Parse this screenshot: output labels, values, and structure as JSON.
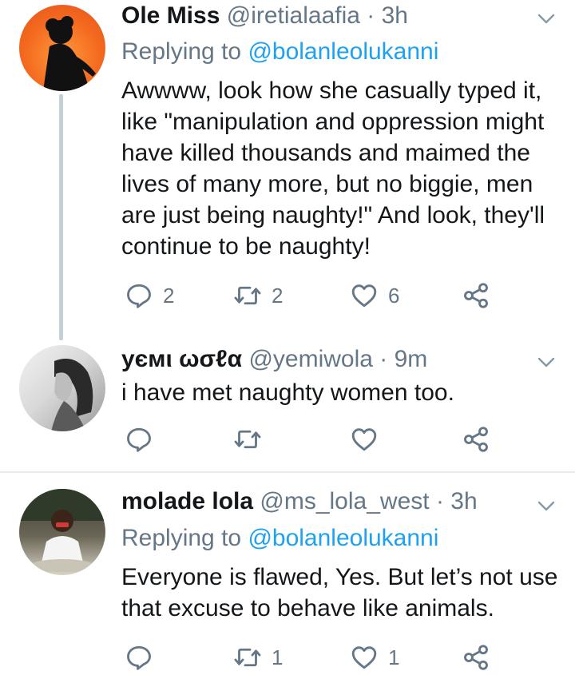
{
  "tweets": [
    {
      "name": "Ole Miss",
      "handle": "@iretialaafia",
      "dot": "·",
      "time": "3h",
      "replying_prefix": "Replying to",
      "replying_to": "@bolanleolukanni",
      "text": "Awwww, look how she casually typed it, like \"manipulation and oppression might have killed thousands and maimed the lives of many more, but no biggie, men are just being naughty!\" And look, they'll continue to be naughty!",
      "replies": "2",
      "retweets": "2",
      "likes": "6"
    },
    {
      "name": "уємι ωσℓα",
      "handle": "@yemiwola",
      "dot": "·",
      "time": "9m",
      "text": "i have met naughty women too.",
      "replies": "",
      "retweets": "",
      "likes": ""
    },
    {
      "name": "molade lola",
      "handle": "@ms_lola_west",
      "dot": "·",
      "time": "3h",
      "replying_prefix": "Replying to",
      "replying_to": "@bolanleolukanni",
      "text": "Everyone is flawed, Yes. But let’s not use that excuse to behave like animals.",
      "replies": "",
      "retweets": "1",
      "likes": "1"
    }
  ],
  "icons": [
    "reply-icon",
    "retweet-icon",
    "like-icon",
    "share-icon",
    "chevron-down-icon"
  ],
  "colors": {
    "accent": "#1da1f2",
    "muted": "#657786",
    "thread_line": "#c4cfd6"
  }
}
